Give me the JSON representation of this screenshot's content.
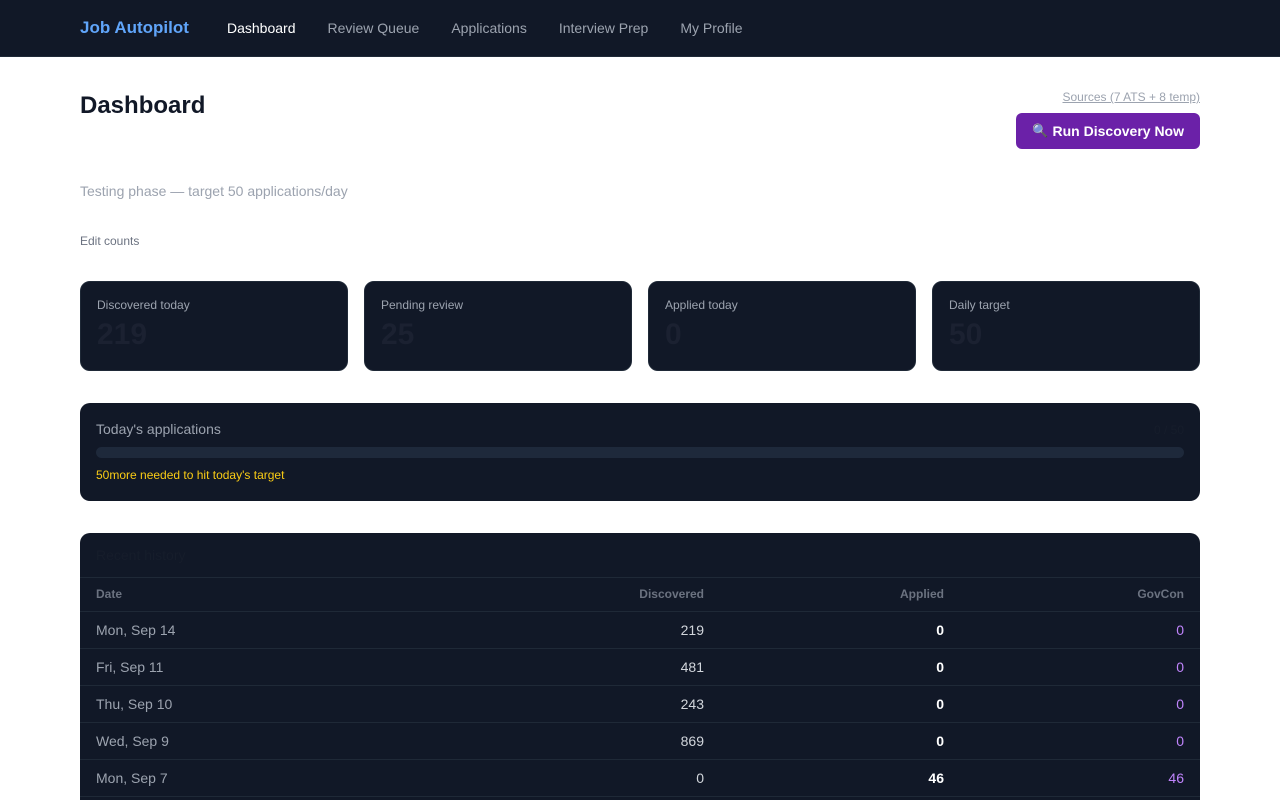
{
  "nav": {
    "brand": "Job Autopilot",
    "links": [
      {
        "label": "Dashboard",
        "active": true
      },
      {
        "label": "Review Queue",
        "active": false
      },
      {
        "label": "Applications",
        "active": false
      },
      {
        "label": "Interview Prep",
        "active": false
      },
      {
        "label": "My Profile",
        "active": false
      }
    ]
  },
  "header": {
    "title": "Dashboard",
    "sources_link": "Sources (7 ATS + 8 temp)",
    "run_button_icon": "🔍",
    "run_button_label": "Run Discovery Now",
    "subtitle": "Testing phase — target 50 applications/day",
    "edit_counts": "Edit counts"
  },
  "stats": [
    {
      "label": "Discovered today",
      "value": "219"
    },
    {
      "label": "Pending review",
      "value": "25"
    },
    {
      "label": "Applied today",
      "value": "0"
    },
    {
      "label": "Daily target",
      "value": "50"
    }
  ],
  "progress": {
    "title": "Today's applications",
    "count": "0 / 50",
    "fraction": 0,
    "note": "50more needed to hit today's target"
  },
  "history": {
    "title": "Recent history",
    "columns": [
      "Date",
      "Discovered",
      "Applied",
      "GovCon"
    ],
    "rows": [
      [
        "Mon, Sep 14",
        "219",
        "0",
        "0"
      ],
      [
        "Fri, Sep 11",
        "481",
        "0",
        "0"
      ],
      [
        "Thu, Sep 10",
        "243",
        "0",
        "0"
      ],
      [
        "Wed, Sep 9",
        "869",
        "0",
        "0"
      ],
      [
        "Mon, Sep 7",
        "0",
        "46",
        "46"
      ]
    ]
  },
  "colors": {
    "nav_bg": "#111827",
    "brand": "#60a5fa",
    "accent": "#6b21a8",
    "warning": "#facc15",
    "govcon": "#c084fc"
  }
}
